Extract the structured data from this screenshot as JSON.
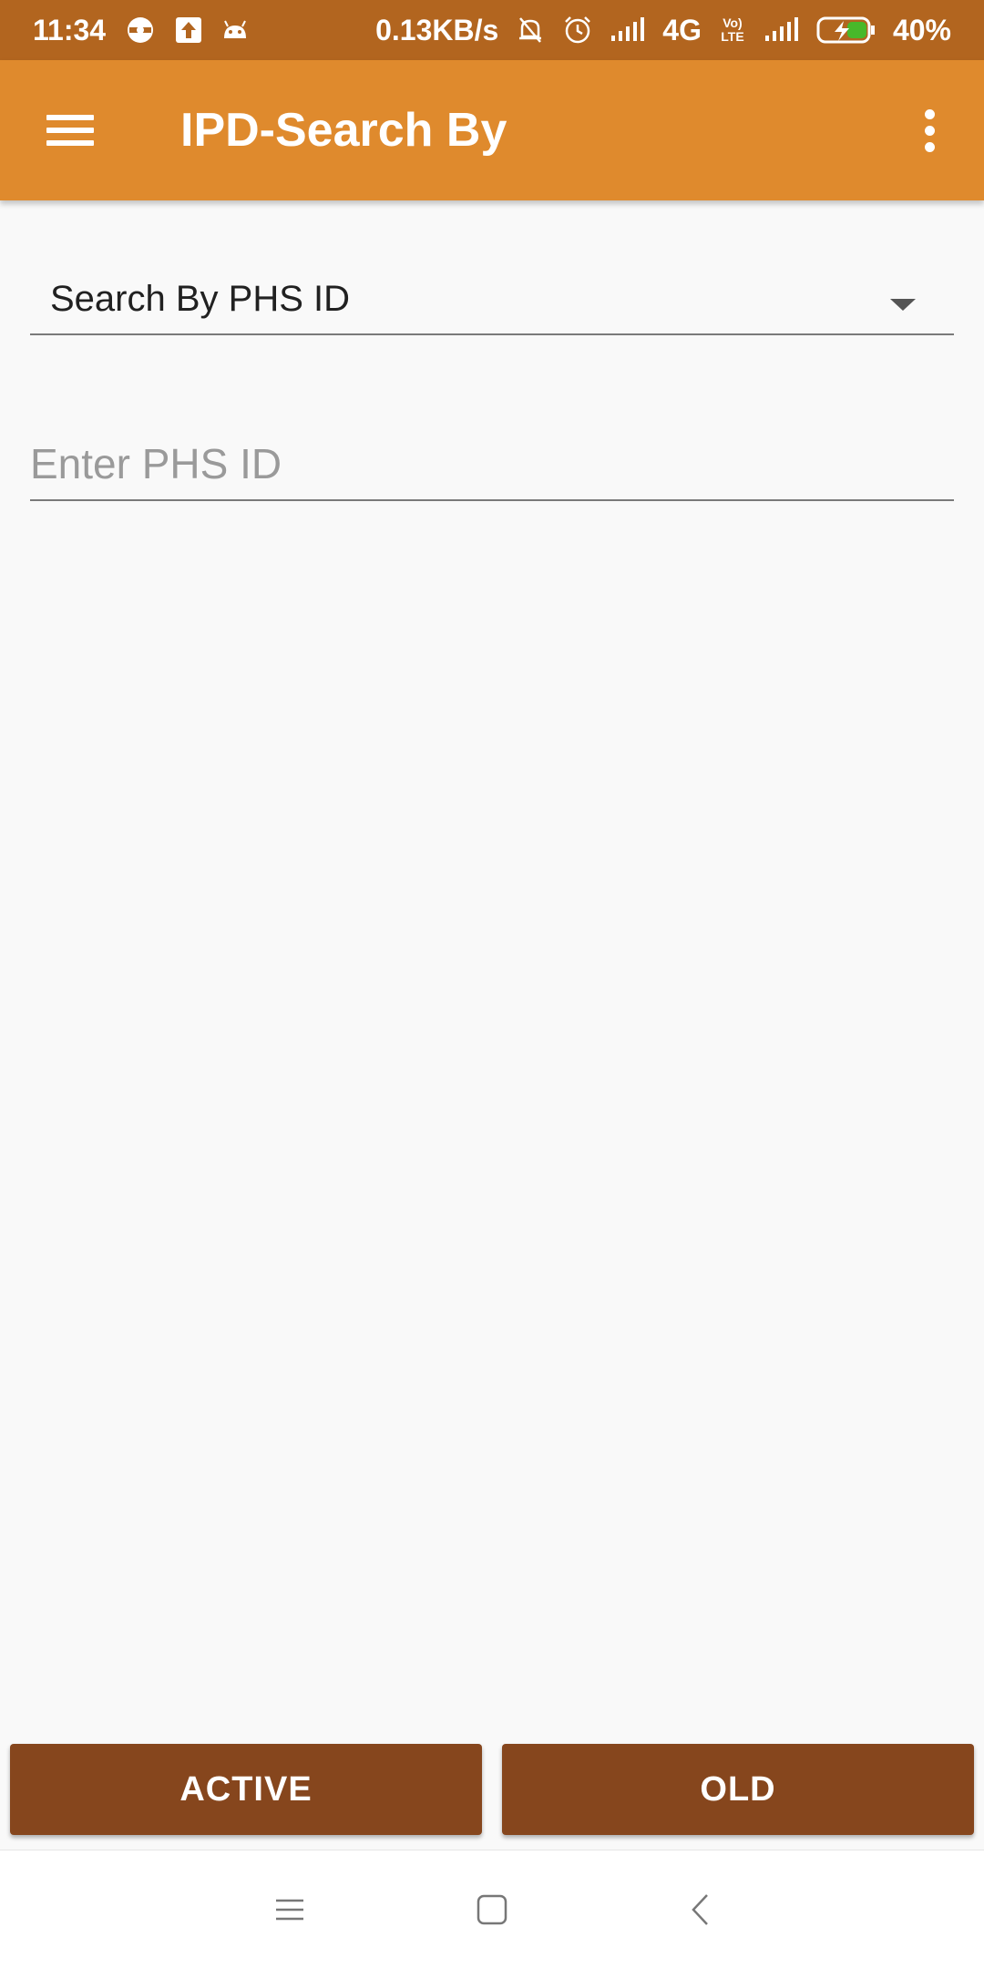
{
  "status_bar": {
    "time": "11:34",
    "net_speed": "0.13KB/s",
    "network": "4G",
    "volte": "Vo) LTE",
    "battery": "40%",
    "left_icons": [
      "vpn-icon",
      "upload-icon",
      "android-debug-icon"
    ],
    "right_icons": [
      "mute-icon",
      "alarm-icon",
      "signal-icon",
      "signal-icon",
      "battery-charging-icon"
    ]
  },
  "app_bar": {
    "title": "IPD-Search By",
    "menu_icon": "hamburger-menu-icon",
    "overflow_icon": "more-vert-icon"
  },
  "search": {
    "selected_option": "Search By PHS ID",
    "input_placeholder": "Enter PHS ID",
    "input_value": ""
  },
  "buttons": {
    "active_label": "ACTIVE",
    "old_label": "OLD"
  },
  "colors": {
    "status_bar": "#b2651f",
    "app_bar": "#df8a2d",
    "button": "#86461d",
    "background": "#f9f9f9"
  },
  "nav_bar": {
    "icons": [
      "recent-apps-icon",
      "home-icon",
      "back-icon"
    ]
  }
}
